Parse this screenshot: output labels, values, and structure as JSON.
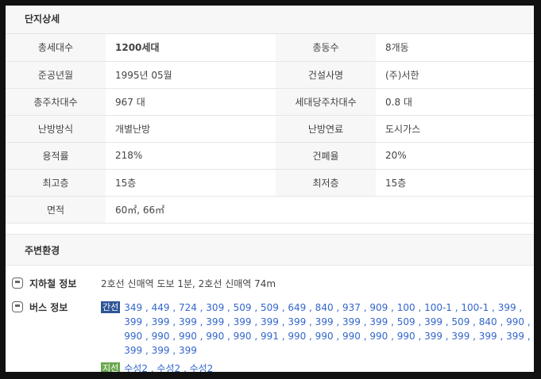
{
  "detail": {
    "title": "단지상세",
    "rows": [
      {
        "l1": "총세대수",
        "v1": "1200세대",
        "l2": "총동수",
        "v2": "8개동"
      },
      {
        "l1": "준공년월",
        "v1": "1995년 05월",
        "l2": "건설사명",
        "v2": "(주)서한"
      },
      {
        "l1": "총주차대수",
        "v1": "967 대",
        "l2": "세대당주차대수",
        "v2": "0.8 대"
      },
      {
        "l1": "난방방식",
        "v1": "개별난방",
        "l2": "난방연료",
        "v2": "도시가스"
      },
      {
        "l1": "용적률",
        "v1": "218%",
        "l2": "건폐율",
        "v2": "20%"
      },
      {
        "l1": "최고층",
        "v1": "15층",
        "l2": "최저층",
        "v2": "15층"
      },
      {
        "l1": "면적",
        "v1": "60㎡, 66㎡",
        "l2": "",
        "v2": ""
      }
    ]
  },
  "environment": {
    "title": "주변환경",
    "subway": {
      "label": "지하철 정보",
      "text": "2호선 신매역 도보 1분, 2호선 신매역 74m"
    },
    "bus": {
      "label": "버스 정보",
      "trunk_tag": "간선",
      "trunk_routes": "349 , 449 , 724 , 309 , 509 , 509 , 649 , 840 , 937 , 909 , 100 , 100-1 , 100-1 , 399 , 399 , 399 , 399 , 399 , 399 , 399 , 399 , 399 , 399 , 399 , 509 , 399 , 509 , 840 , 990 , 990 , 990 , 990 , 990 , 990 , 991 , 990 , 990 , 990 , 990 , 990 , 399 , 399 , 399 , 399 , 399 , 399 , 399",
      "branch_tag": "지선",
      "branch_routes": "수성2 , 수성2 , 수성2"
    }
  },
  "colors": {
    "link": "#3366cc",
    "trunk_tag_bg": "#2f5596",
    "branch_tag_bg": "#6aa84f",
    "label_bg": "#f7f7f7"
  },
  "icons": {
    "subway": "subway-icon",
    "bus": "bus-icon"
  }
}
